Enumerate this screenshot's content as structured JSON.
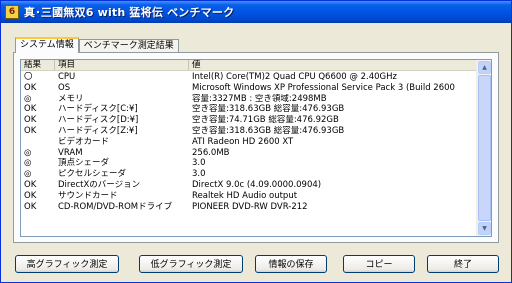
{
  "window": {
    "title": "真･三國無双6 with 猛将伝 ベンチマーク",
    "icon_label": "6"
  },
  "tabs": [
    {
      "label": "システム情報",
      "active": true
    },
    {
      "label": "ベンチマーク測定結果",
      "active": false
    }
  ],
  "table": {
    "headers": {
      "status": "結果",
      "item": "項目",
      "value": "値"
    },
    "rows": [
      {
        "status": "〇",
        "item": "CPU",
        "value": "Intel(R) Core(TM)2 Quad CPU    Q6600  @ 2.40GHz"
      },
      {
        "status": "OK",
        "item": "OS",
        "value": "Microsoft Windows XP Professional Service Pack 3 (Build 2600"
      },
      {
        "status": "◎",
        "item": "メモリ",
        "value": "容量:3327MB  : 空き領域:2498MB"
      },
      {
        "status": "OK",
        "item": "ハードディスク[C:¥]",
        "value": "空き容量:318.63GB  総容量:476.93GB"
      },
      {
        "status": "OK",
        "item": "ハードディスク[D:¥]",
        "value": "空き容量:74.71GB  総容量:476.92GB"
      },
      {
        "status": "OK",
        "item": "ハードディスク[Z:¥]",
        "value": "空き容量:318.63GB  総容量:476.93GB"
      },
      {
        "status": "",
        "item": "ビデオカード",
        "value": "ATI Radeon HD 2600 XT"
      },
      {
        "status": "◎",
        "item": "VRAM",
        "value": "256.0MB"
      },
      {
        "status": "◎",
        "item": "頂点シェーダ",
        "value": "3.0"
      },
      {
        "status": "◎",
        "item": "ピクセルシェーダ",
        "value": "3.0"
      },
      {
        "status": "OK",
        "item": "DirectXのバージョン",
        "value": "DirectX 9.0c (4.09.0000.0904)"
      },
      {
        "status": "OK",
        "item": "サウンドカード",
        "value": "Realtek HD Audio output"
      },
      {
        "status": "OK",
        "item": "CD-ROM/DVD-ROMドライブ",
        "value": "PIONEER DVD-RW  DVR-212"
      }
    ]
  },
  "buttons": {
    "high_graphics": "高グラフィック測定",
    "low_graphics": "低グラフィック測定",
    "save_info": "情報の保存",
    "copy": "コピー",
    "exit": "終了"
  },
  "colors": {
    "titlebar": "#0054e3",
    "active_tab_accent": "#ffc83c",
    "window_bg": "#ece9d8"
  }
}
